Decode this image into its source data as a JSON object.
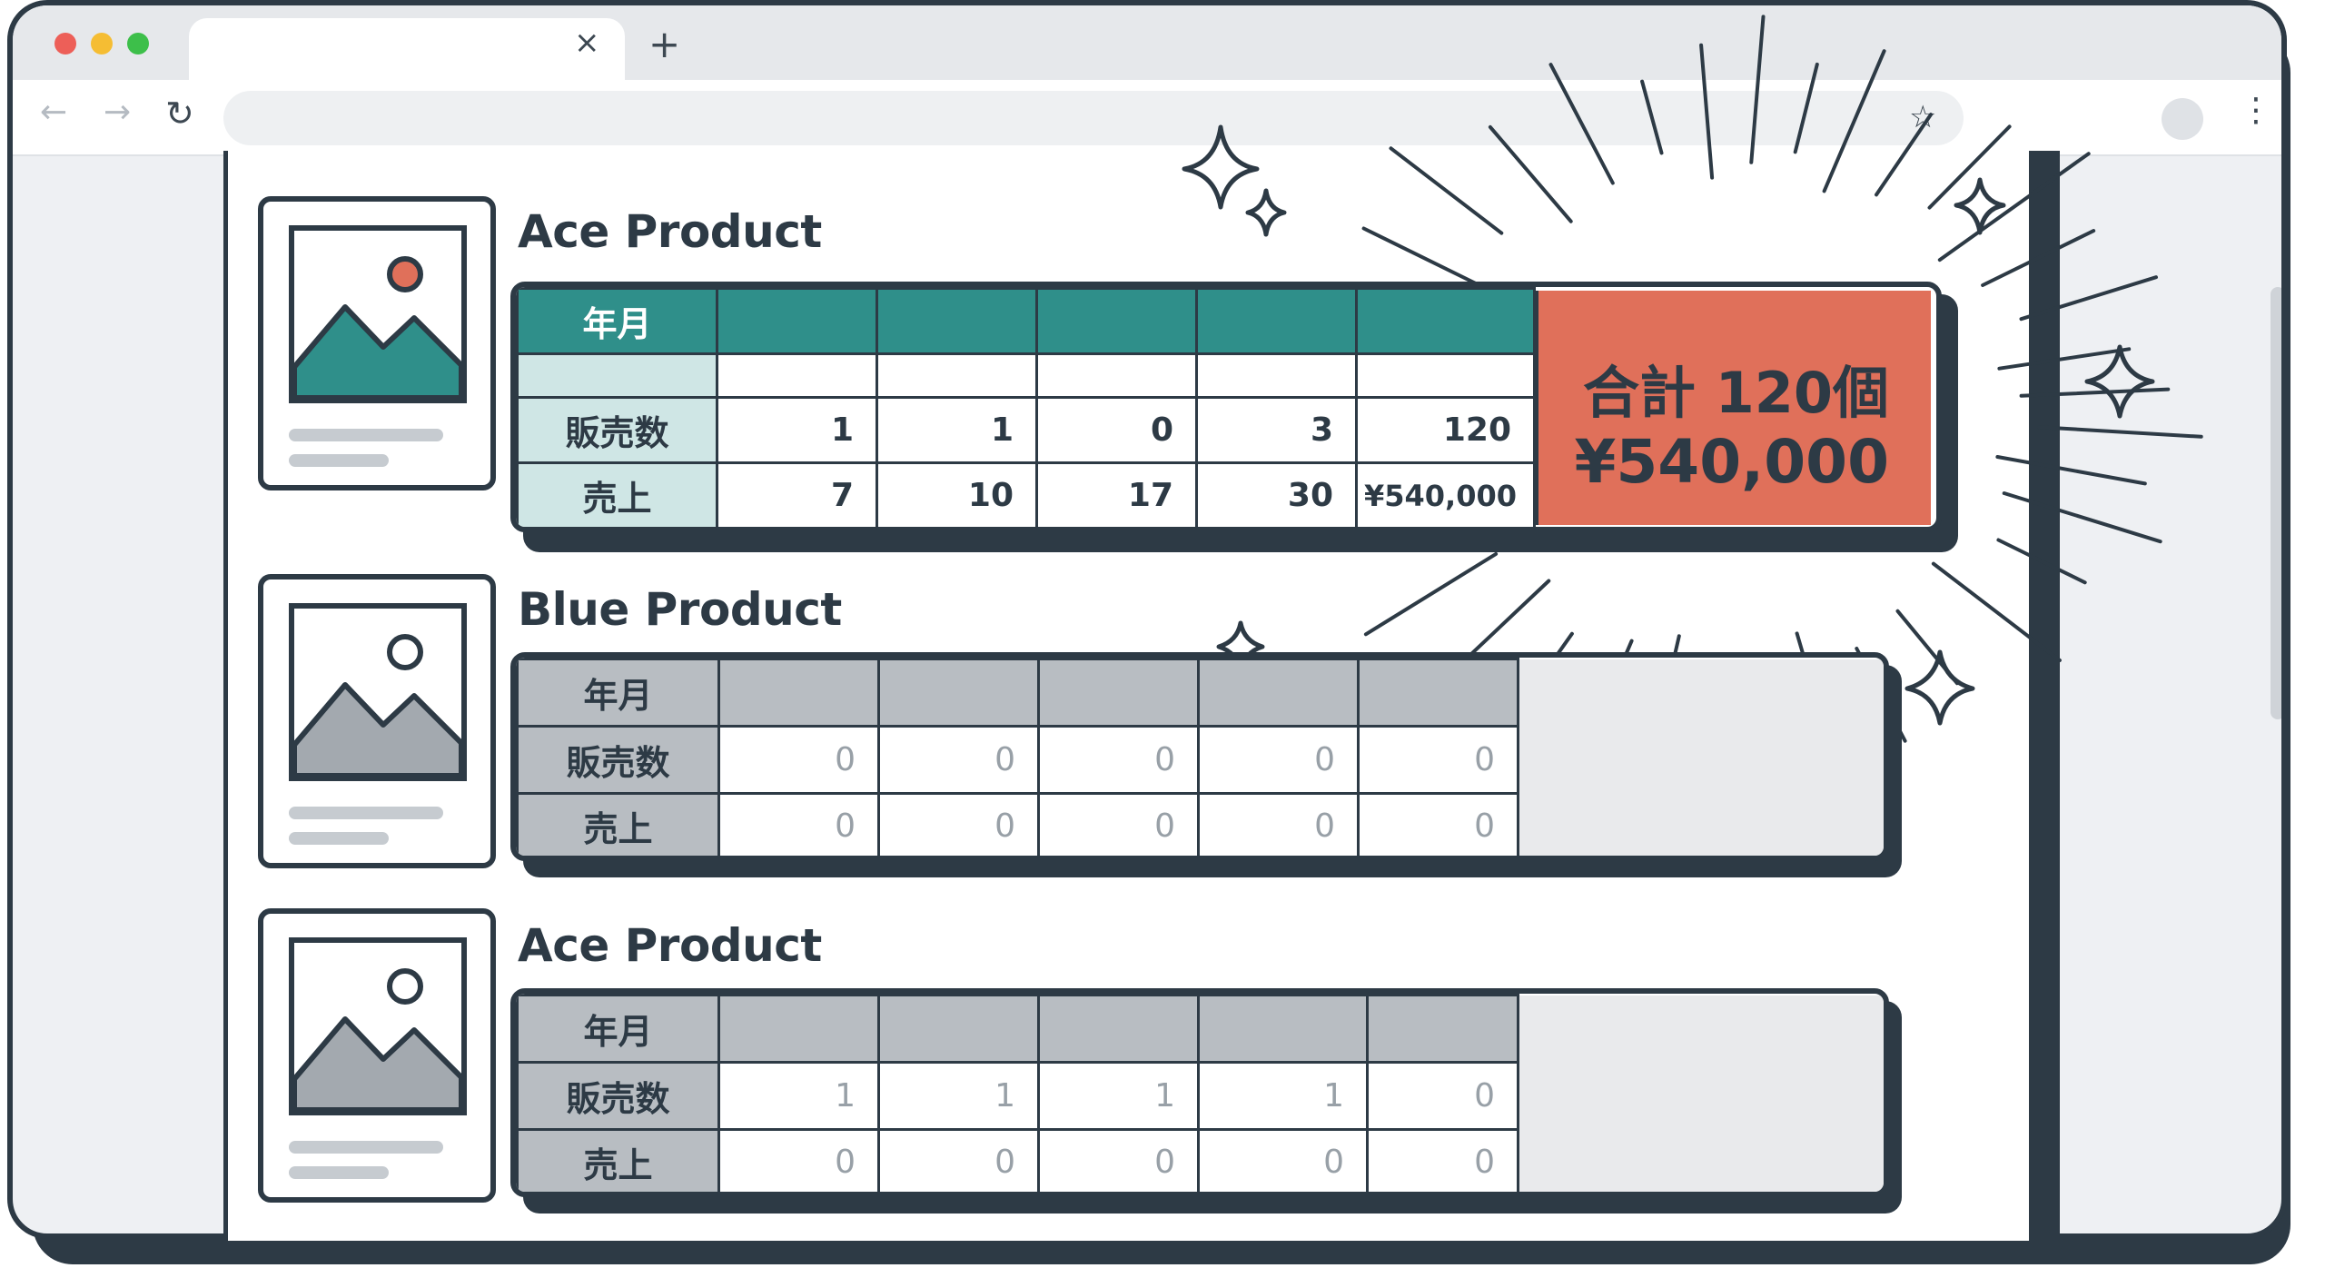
{
  "browser": {
    "tab_close": "×",
    "tab_new": "+",
    "icons": [
      "back-arrow-icon",
      "forward-arrow-icon",
      "reload-icon",
      "bookmark-star-icon",
      "profile-icon",
      "more-menu-icon"
    ]
  },
  "products": [
    {
      "title": "Ace Product",
      "rows": {
        "month": "年月",
        "units": "販売数",
        "sales": "売上"
      },
      "units": [
        "1",
        "1",
        "0",
        "3",
        "120"
      ],
      "sales": [
        "7",
        "10",
        "17",
        "30",
        "¥540,000"
      ],
      "total": {
        "count": "合計 120個",
        "amount": "¥540,000"
      }
    },
    {
      "title": "Blue Product",
      "rows": {
        "month": "年月",
        "units": "販売数",
        "sales": "売上"
      },
      "units": [
        "0",
        "0",
        "0",
        "0",
        "0"
      ],
      "sales": [
        "0",
        "0",
        "0",
        "0",
        "0"
      ]
    },
    {
      "title": "Ace Product",
      "rows": {
        "month": "年月",
        "units": "販売数",
        "sales": "売上"
      },
      "units": [
        "1",
        "1",
        "1",
        "1",
        "0"
      ],
      "sales": [
        "0",
        "0",
        "0",
        "0",
        "0"
      ]
    }
  ],
  "colors": {
    "accent_teal": "#2f8f8a",
    "highlight_coral": "#e0705a",
    "outline": "#2d3a45",
    "inactive_gray": "#b8bdc2"
  }
}
